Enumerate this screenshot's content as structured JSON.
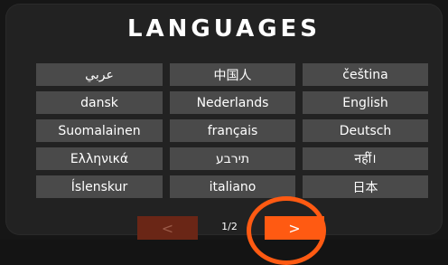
{
  "title": "LANGUAGES",
  "languages": [
    "عربي",
    "中国人",
    "čeština",
    "dansk",
    "Nederlands",
    "English",
    "Suomalainen",
    "français",
    "Deutsch",
    "Ελληνικά",
    "תירבע",
    "नहीं।",
    "Íslenskur",
    "italiano",
    "日本"
  ],
  "pager": {
    "prev_label": "<",
    "page_indicator": "1/2",
    "next_label": ">"
  },
  "colors": {
    "accent": "#ff5a12",
    "button_bg": "#4a4a4a",
    "panel_bg": "#222222"
  }
}
